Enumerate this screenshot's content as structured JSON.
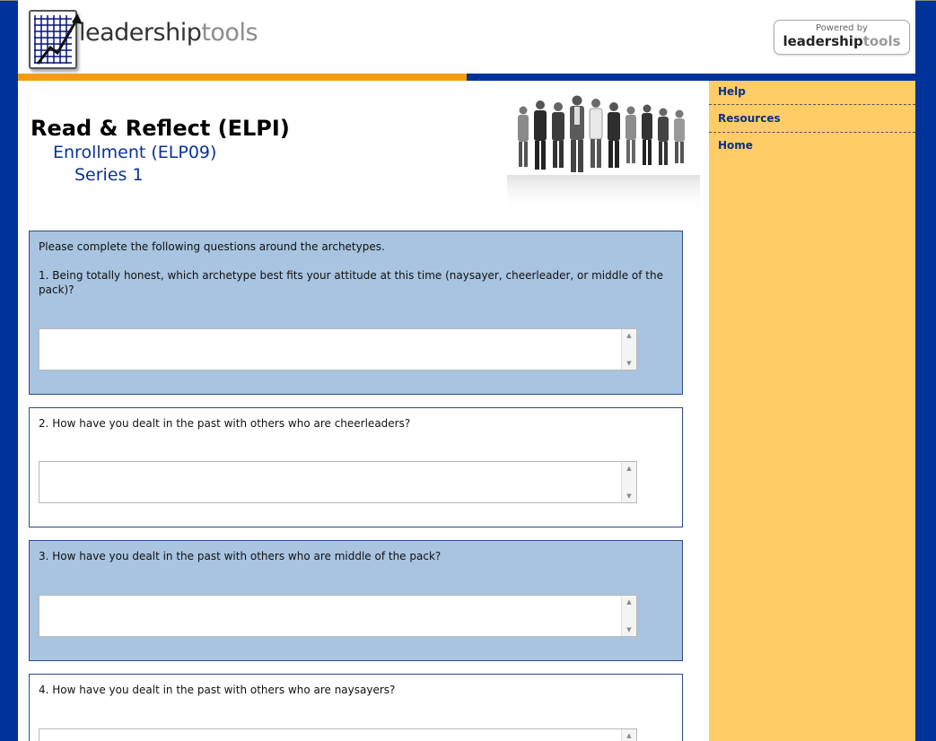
{
  "brand": {
    "logo_text_a": "leadership",
    "logo_text_b": "tools",
    "powered_label": "Powered by",
    "powered_text_a": "leadership",
    "powered_text_b": "tools"
  },
  "sidebar": {
    "items": [
      {
        "label": "Help"
      },
      {
        "label": "Resources"
      },
      {
        "label": "Home"
      }
    ]
  },
  "page": {
    "title": "Read & Reflect (ELPI)",
    "subtitle": "Enrollment (ELP09)",
    "series": "Series 1"
  },
  "questions": {
    "intro": "Please complete the following questions around the archetypes.",
    "q1": "1. Being totally honest, which archetype best fits your attitude at this time (naysayer, cheerleader, or middle of the pack)?",
    "q2": "2. How have you dealt in the past with others who are cheerleaders?",
    "q3": "3. How have you dealt in the past with others who are middle of the pack?",
    "q4": "4. How have you dealt in the past with others who are naysayers?"
  },
  "colors": {
    "frame_blue": "#003399",
    "accent_orange": "#f39c12",
    "sidebar_bg": "#ffcc66",
    "question_shade": "#a8c4e0"
  },
  "icons": [
    "chart-grid-logo-icon",
    "scroll-up-icon",
    "scroll-down-icon"
  ]
}
